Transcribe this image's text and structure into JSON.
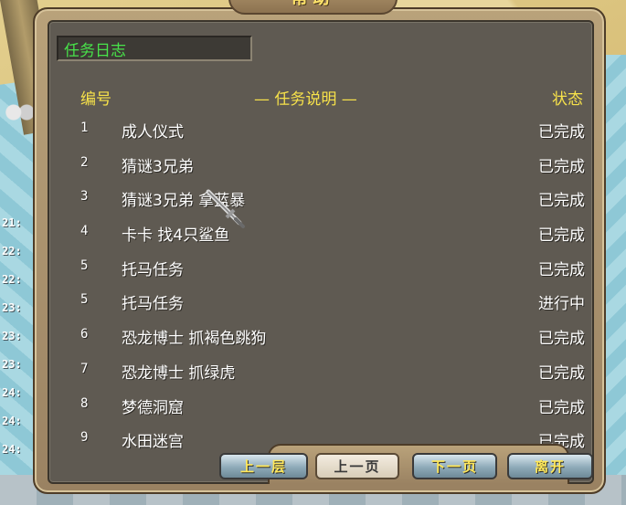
{
  "title": "帮助",
  "window_header": "任务日志",
  "columns": {
    "number": "编号",
    "description": "— 任务说明 —",
    "status": "状态"
  },
  "side_numbers": [
    "21:",
    "22:",
    "22:",
    "23:",
    "23:",
    "23:",
    "24:",
    "24:",
    "24:"
  ],
  "tasks": [
    {
      "num": "1",
      "desc": "成人仪式",
      "status": "已完成"
    },
    {
      "num": "2",
      "desc": "猜谜3兄弟",
      "status": "已完成"
    },
    {
      "num": "3",
      "desc": "猜谜3兄弟  拿蓝暴",
      "status": "已完成"
    },
    {
      "num": "4",
      "desc": "卡卡  找4只鲨鱼",
      "status": "已完成"
    },
    {
      "num": "5",
      "desc": "托马任务",
      "status": "已完成"
    },
    {
      "num": "5",
      "desc": "托马任务",
      "status": "进行中"
    },
    {
      "num": "6",
      "desc": "恐龙博士 抓褐色跳狗",
      "status": "已完成"
    },
    {
      "num": "7",
      "desc": "恐龙博士 抓绿虎",
      "status": "已完成"
    },
    {
      "num": "8",
      "desc": "梦德洞窟",
      "status": "已完成"
    },
    {
      "num": "9",
      "desc": "水田迷宫",
      "status": "已完成"
    }
  ],
  "buttons": {
    "prev_floor": "上一层",
    "prev_page": "上一页",
    "next_page": "下一页",
    "leave": "离开"
  },
  "colors": {
    "header_text": "#48e24a",
    "column_text": "#f7e24a",
    "row_text": "#ffffff",
    "panel_bg": "#5f5a52"
  },
  "icons": {
    "cursor": "sword-cursor-icon"
  }
}
